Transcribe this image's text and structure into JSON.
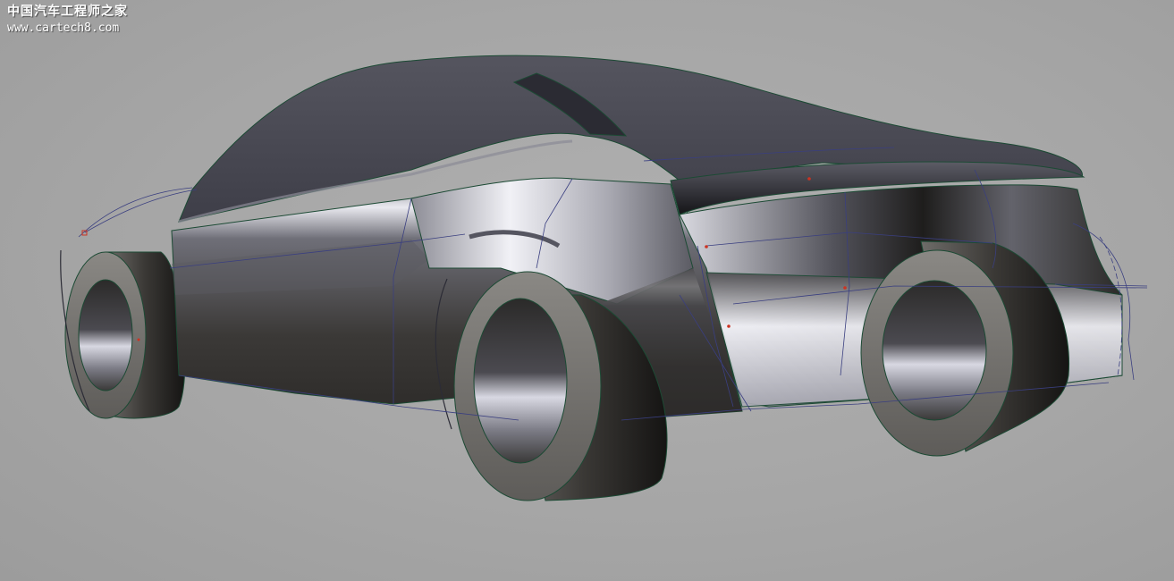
{
  "watermark": {
    "title": "中国汽车工程师之家",
    "url": "www.cartech8.com"
  },
  "viewport": {
    "background": "#a4a4a4",
    "content": "3D CAD surface model of car rear three-quarter view",
    "icons": [
      "car-model-icon",
      "wheel-icon",
      "surface-grid-icon"
    ]
  },
  "colors": {
    "body_dark": "#3a3836",
    "body_light": "#e8e8ee",
    "roof": "#4d4d58",
    "edge_green": "#1c4a34",
    "curve_blue": "#3a3f80",
    "point_red": "#cc3322"
  }
}
